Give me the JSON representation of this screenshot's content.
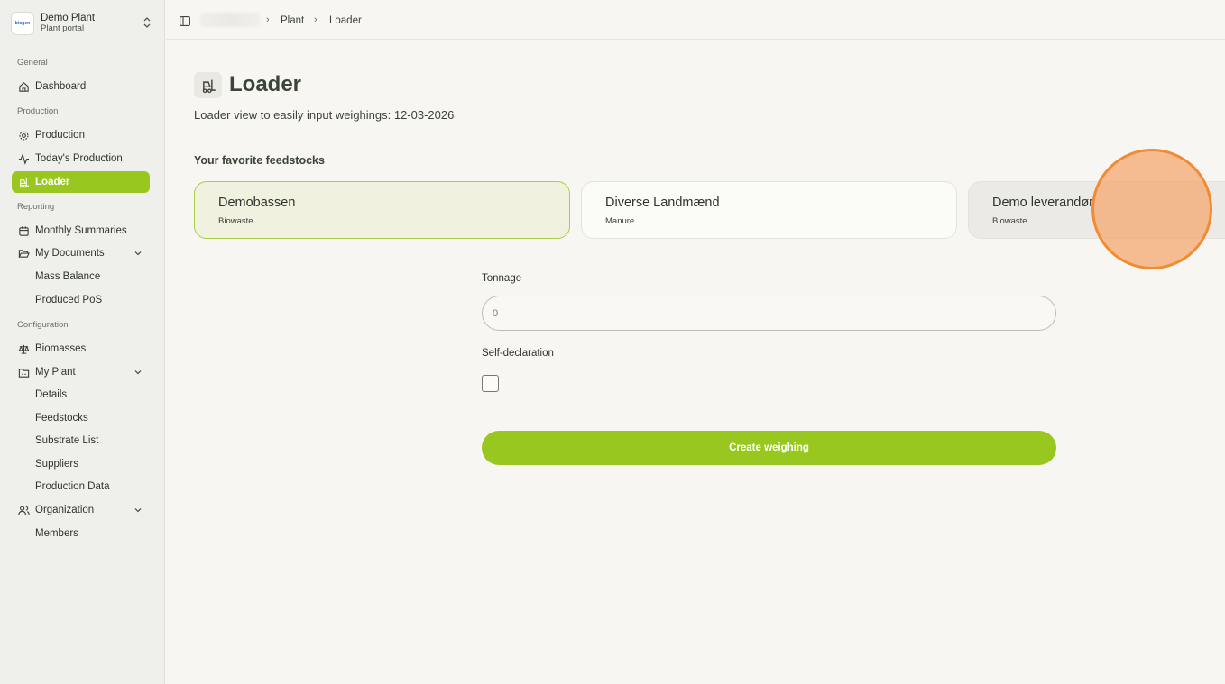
{
  "org": {
    "logo_text": "biogen",
    "name": "Demo Plant",
    "subtitle": "Plant portal"
  },
  "sidebar": {
    "sections": {
      "general": "General",
      "production": "Production",
      "reporting": "Reporting",
      "configuration": "Configuration"
    },
    "items": {
      "dashboard": "Dashboard",
      "production": "Production",
      "todays_production": "Today's Production",
      "loader": "Loader",
      "monthly_summaries": "Monthly Summaries",
      "my_documents": "My Documents",
      "mass_balance": "Mass Balance",
      "produced_pos": "Produced PoS",
      "biomasses": "Biomasses",
      "my_plant": "My Plant",
      "details": "Details",
      "feedstocks": "Feedstocks",
      "substrate_list": "Substrate List",
      "suppliers": "Suppliers",
      "production_data": "Production Data",
      "organization": "Organization",
      "members": "Members"
    }
  },
  "breadcrumb": {
    "plant": "Plant",
    "loader": "Loader"
  },
  "page": {
    "title": "Loader",
    "subtitle": "Loader view to easily input weighings: 12-03-2026",
    "favorites_heading": "Your favorite feedstocks"
  },
  "feedstocks": [
    {
      "name": "Demobassen",
      "type": "Biowaste",
      "selected": true
    },
    {
      "name": "Diverse Landmænd",
      "type": "Manure",
      "selected": false
    },
    {
      "name": "Demo leverandør",
      "type": "Biowaste",
      "selected": false
    }
  ],
  "form": {
    "tonnage_label": "Tonnage",
    "tonnage_placeholder": "0",
    "self_declaration_label": "Self-declaration",
    "self_declaration_checked": false,
    "submit_label": "Create weighing"
  },
  "colors": {
    "accent": "#98c81f",
    "background": "#f7f6f2",
    "sidebar": "#efefeb"
  }
}
